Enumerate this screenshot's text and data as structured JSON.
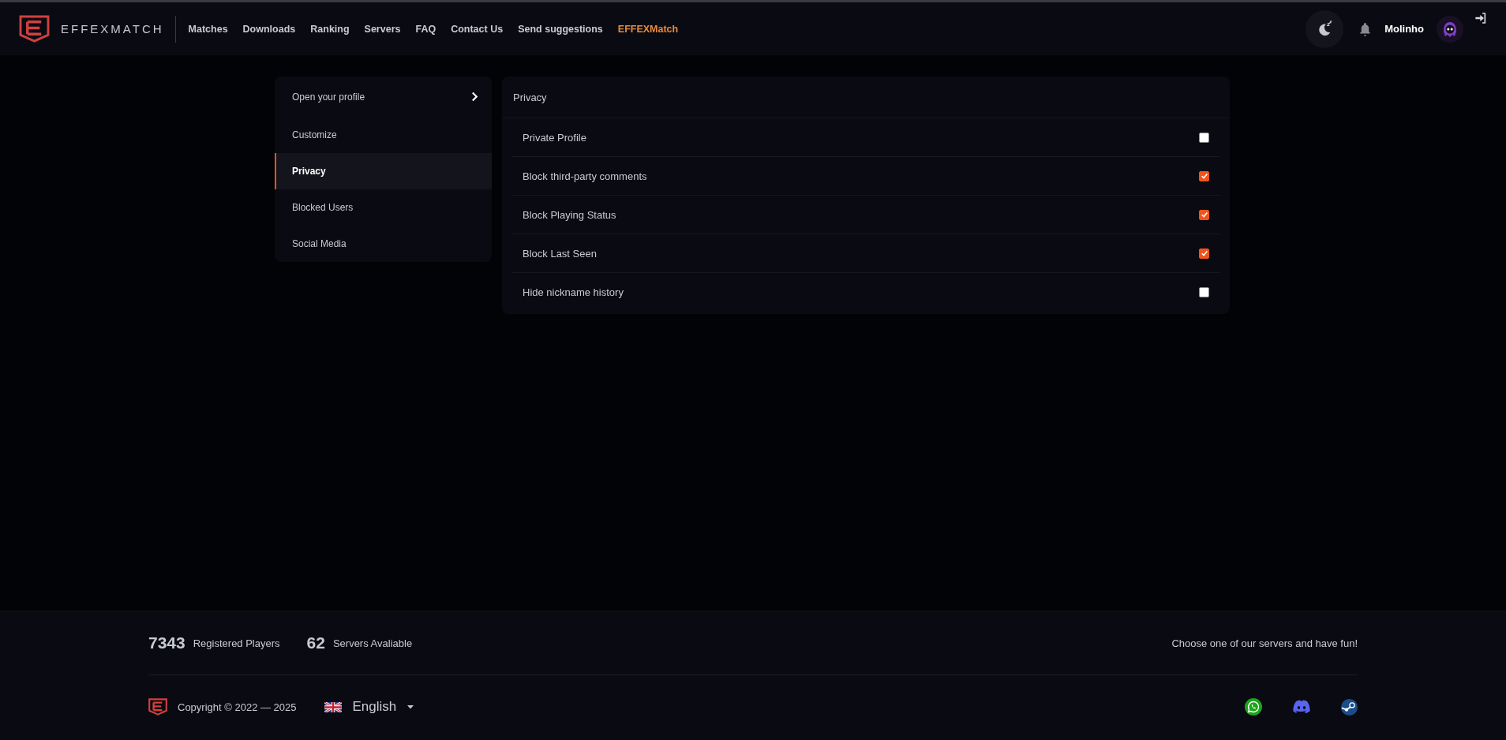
{
  "header": {
    "brand": "EFFEXMATCH",
    "nav": [
      {
        "label": "Matches",
        "highlighted": false
      },
      {
        "label": "Downloads",
        "highlighted": false
      },
      {
        "label": "Ranking",
        "highlighted": false
      },
      {
        "label": "Servers",
        "highlighted": false
      },
      {
        "label": "FAQ",
        "highlighted": false
      },
      {
        "label": "Contact Us",
        "highlighted": false
      },
      {
        "label": "Send suggestions",
        "highlighted": false
      },
      {
        "label": "EFFEXMatch",
        "highlighted": true
      }
    ],
    "username": "Molinho"
  },
  "sidebar": {
    "items": [
      {
        "label": "Open your profile",
        "kind": "link",
        "selected": false
      },
      {
        "label": "Customize",
        "kind": "item",
        "selected": false
      },
      {
        "label": "Privacy",
        "kind": "item",
        "selected": true
      },
      {
        "label": "Blocked Users",
        "kind": "item",
        "selected": false
      },
      {
        "label": "Social Media",
        "kind": "item",
        "selected": false
      }
    ]
  },
  "privacy": {
    "title": "Privacy",
    "options": [
      {
        "label": "Private Profile",
        "checked": false
      },
      {
        "label": "Block third-party comments",
        "checked": true
      },
      {
        "label": "Block Playing Status",
        "checked": true
      },
      {
        "label": "Block Last Seen",
        "checked": true
      },
      {
        "label": "Hide nickname history",
        "checked": false
      }
    ]
  },
  "footer": {
    "stats": [
      {
        "value": "7343",
        "label": "Registered Players"
      },
      {
        "value": "62",
        "label": "Servers Avaliable"
      }
    ],
    "tagline": "Choose one of our servers and have fun!",
    "copyright": "Copyright © 2022 — 2025",
    "language": "English"
  }
}
